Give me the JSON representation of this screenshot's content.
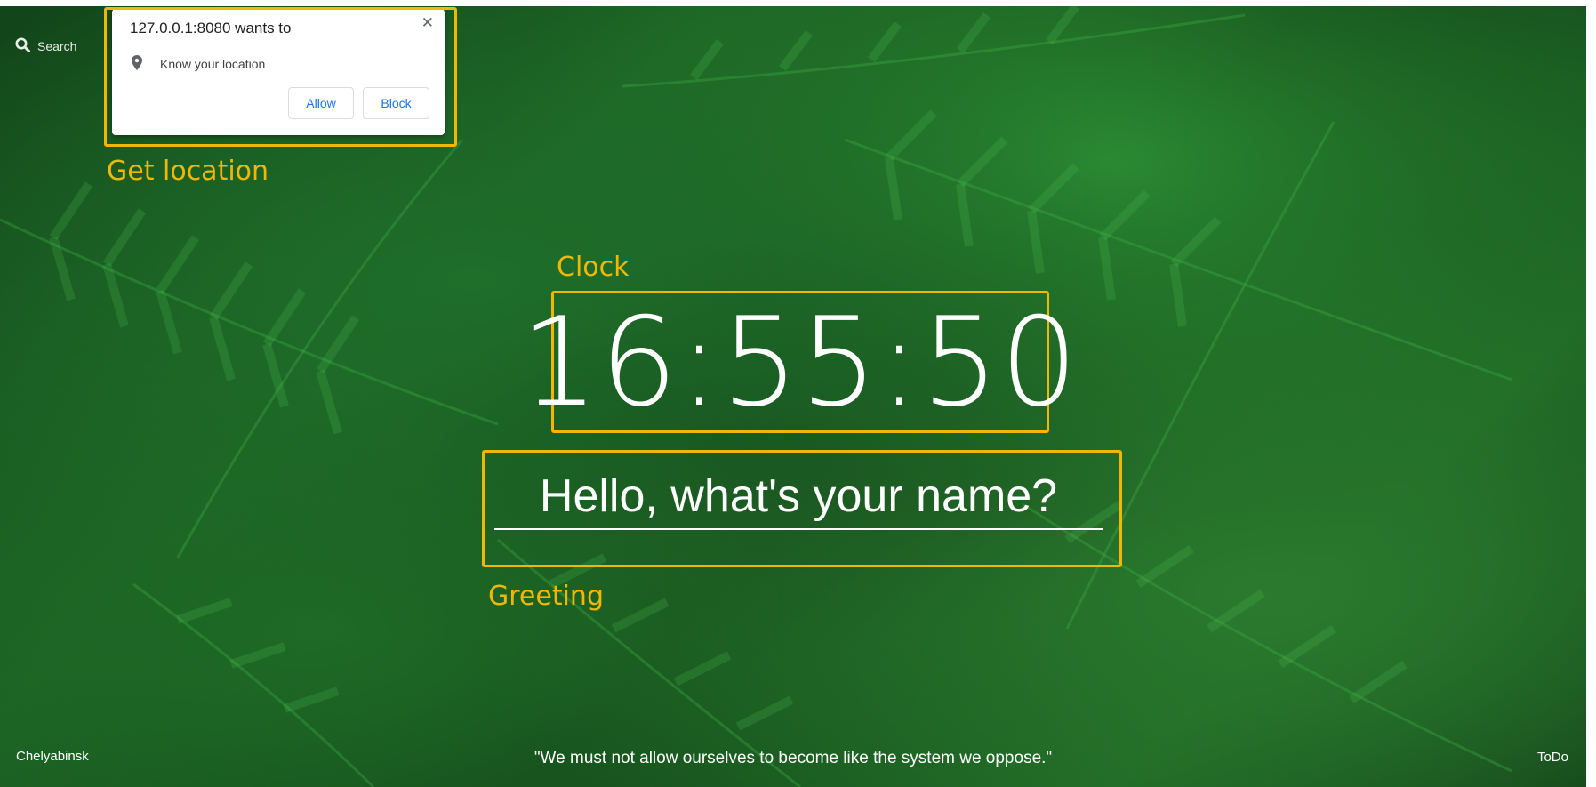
{
  "search": {
    "label": "Search"
  },
  "permission_popup": {
    "title": "127.0.0.1:8080 wants to",
    "close_glyph": "✕",
    "permission": "Know your location",
    "allow_label": "Allow",
    "block_label": "Block"
  },
  "annotations": {
    "get_location": "Get location",
    "clock": "Clock",
    "greeting": "Greeting",
    "color": "#f2b705"
  },
  "clock": {
    "time": "16:55:50"
  },
  "greeting": {
    "text": "Hello, what's your name?"
  },
  "footer": {
    "city": "Chelyabinsk",
    "quote": "\"We must not allow ourselves to become like the system we oppose.\"",
    "todo": "ToDo"
  },
  "icons": {
    "search": "search-icon",
    "location": "location-pin-icon",
    "close": "close-icon"
  }
}
